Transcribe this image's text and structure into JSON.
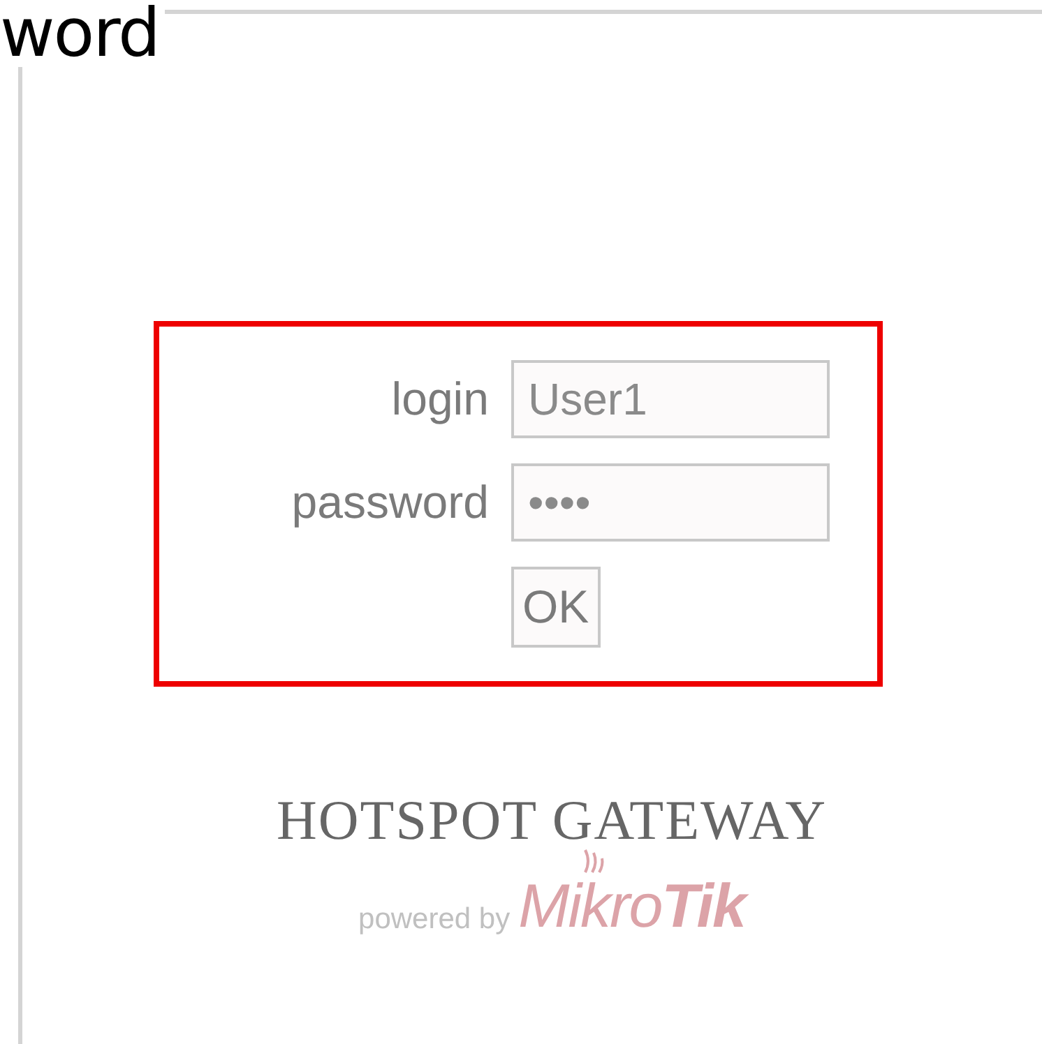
{
  "heading": "word",
  "form": {
    "fields": [
      {
        "label": "login",
        "entry": "User1"
      },
      {
        "label": "password",
        "entry": "••••"
      }
    ],
    "button": "OK"
  },
  "brand": {
    "title": "HOTSPOT GATEWAY",
    "powered_by": "powered by",
    "logo": "Mikro**Tik**"
  }
}
